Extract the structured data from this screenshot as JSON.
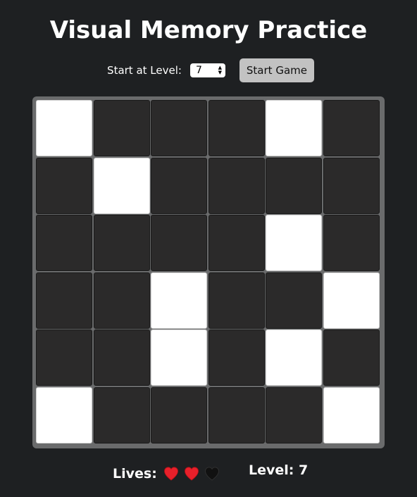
{
  "title": "Visual Memory Practice",
  "controls": {
    "start_level_label": "Start at Level:",
    "start_level_value": "7",
    "start_button_label": "Start Game"
  },
  "board": {
    "rows": 6,
    "cols": 6,
    "cells": [
      [
        1,
        0,
        0,
        0,
        1,
        0
      ],
      [
        0,
        1,
        0,
        0,
        0,
        0
      ],
      [
        0,
        0,
        0,
        0,
        1,
        0
      ],
      [
        0,
        0,
        1,
        0,
        0,
        1
      ],
      [
        0,
        0,
        1,
        0,
        1,
        0
      ],
      [
        1,
        0,
        0,
        0,
        0,
        1
      ]
    ]
  },
  "status": {
    "lives_label": "Lives:",
    "lives_remaining": 2,
    "lives_total": 3,
    "level_label": "Level: 7"
  },
  "colors": {
    "background": "#1e2022",
    "board": "#6a6b6c",
    "cell_off": "#2b2a2a",
    "cell_on": "#ffffff",
    "heart_full": "#e8202a",
    "heart_empty": "#111111"
  }
}
